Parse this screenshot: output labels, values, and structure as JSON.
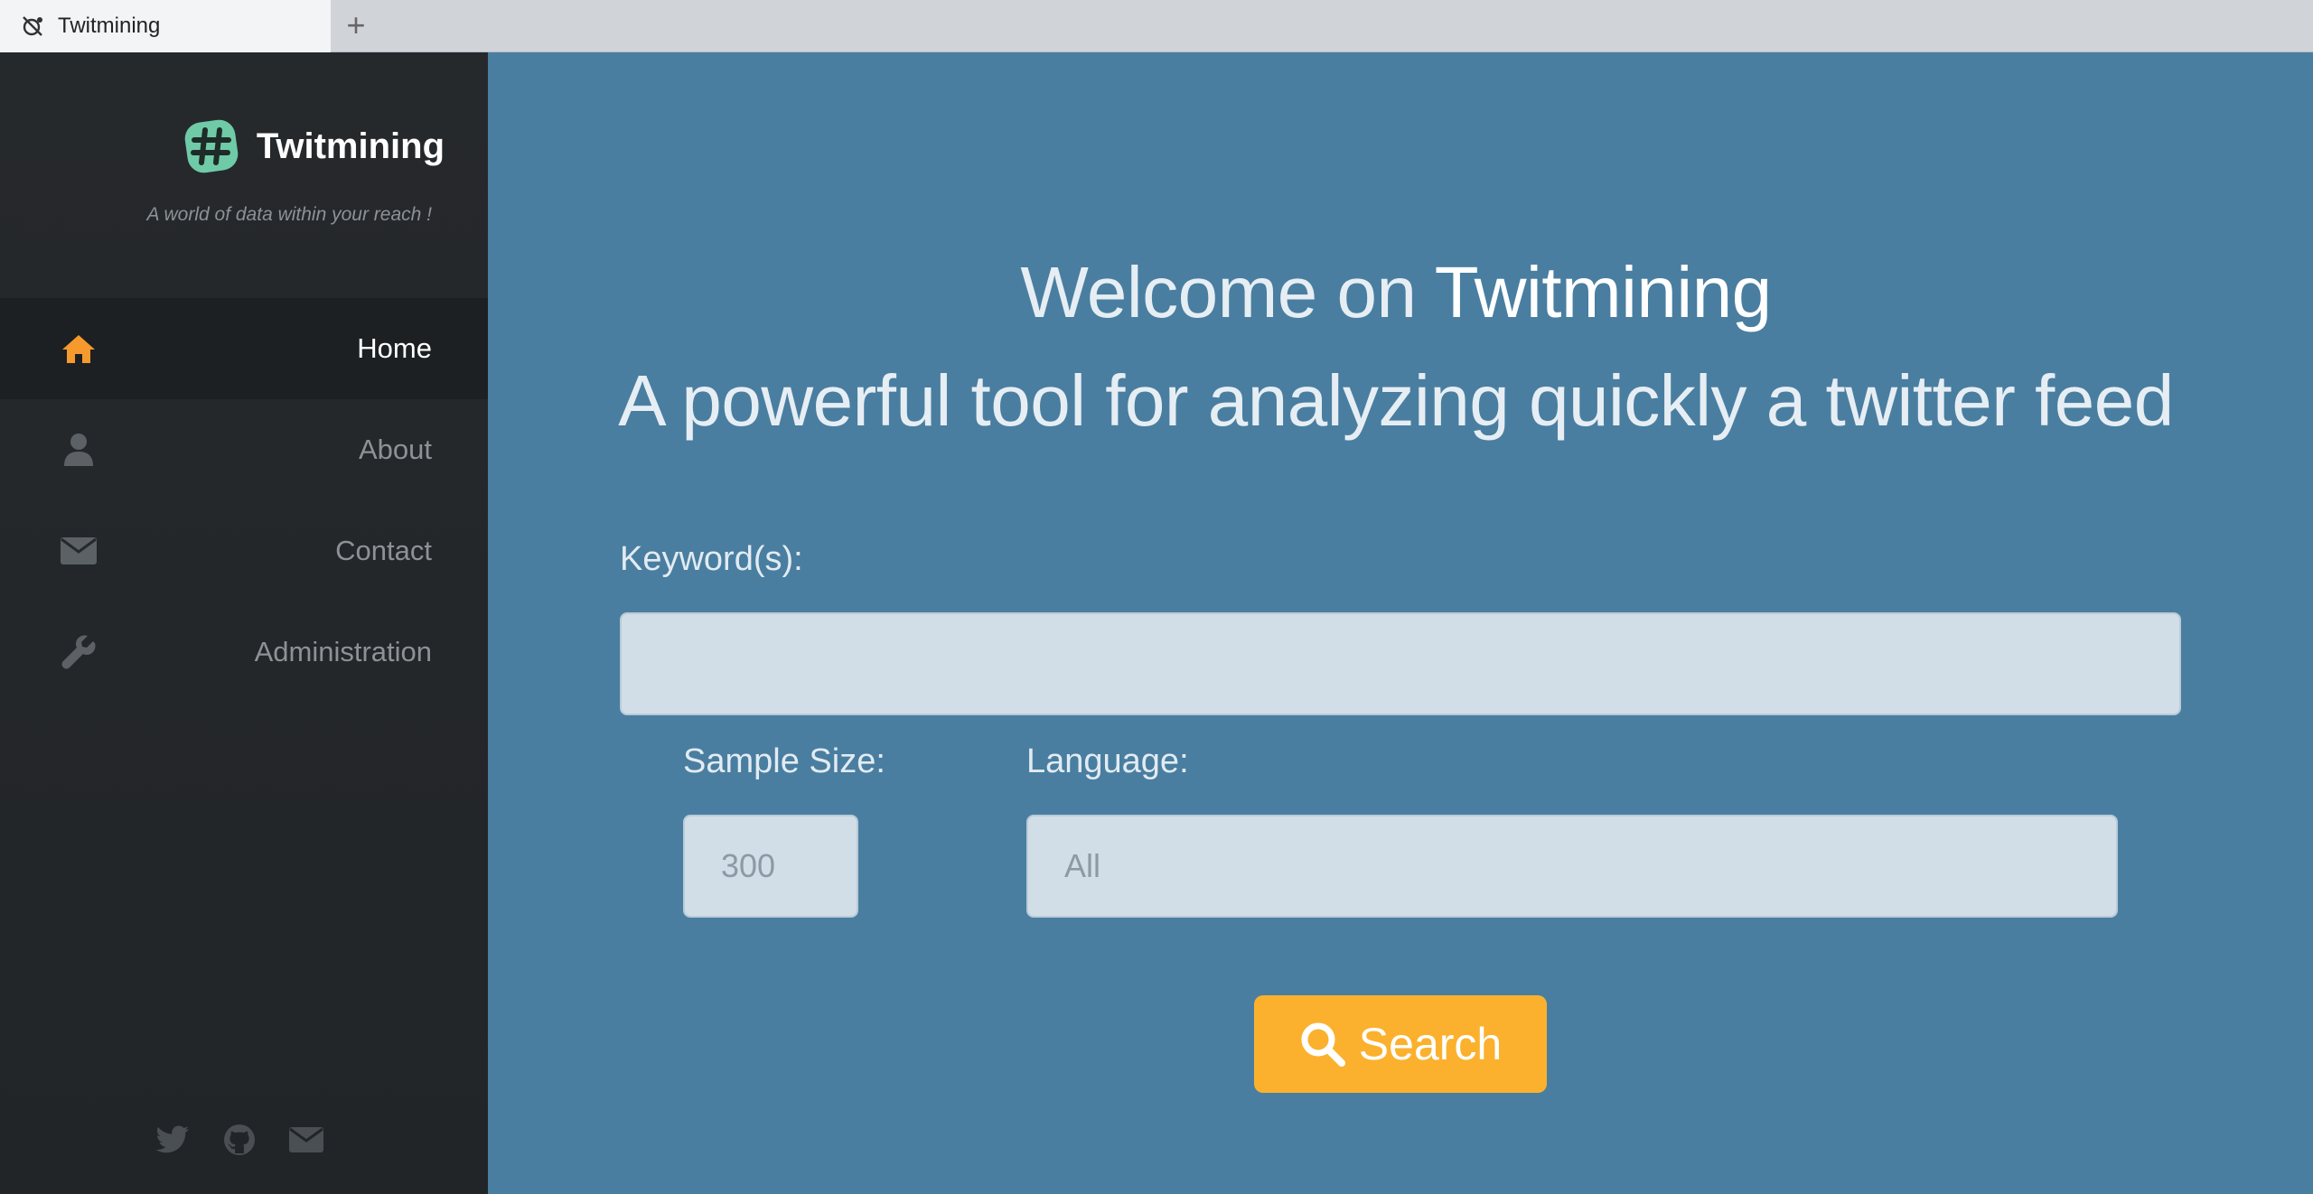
{
  "browser": {
    "tab_title": "Twitmining",
    "new_tab": "+"
  },
  "sidebar": {
    "brand": "Twitmining",
    "tagline": "A world of data within your reach !",
    "items": [
      {
        "label": "Home",
        "icon": "home-icon",
        "active": true
      },
      {
        "label": "About",
        "icon": "user-icon",
        "active": false
      },
      {
        "label": "Contact",
        "icon": "envelope-icon",
        "active": false
      },
      {
        "label": "Administration",
        "icon": "wrench-icon",
        "active": false
      }
    ],
    "social": [
      "twitter-icon",
      "github-icon",
      "envelope-icon"
    ]
  },
  "main": {
    "welcome_prefix": "Welcome on ",
    "welcome_brand": "Twitmining",
    "subtitle": "A powerful tool for analyzing quickly a twitter feed",
    "keyword_label": "Keyword(s):",
    "keyword_value": "",
    "sample_size_label": "Sample Size:",
    "sample_size_placeholder": "300",
    "language_label": "Language:",
    "language_placeholder": "All",
    "search_label": "Search"
  },
  "colors": {
    "accent": "#fbb12d",
    "main_bg": "#497ea0",
    "sidebar_bg": "#26292c",
    "active_icon": "#f79a2d",
    "logo": "#6fcaa8"
  }
}
